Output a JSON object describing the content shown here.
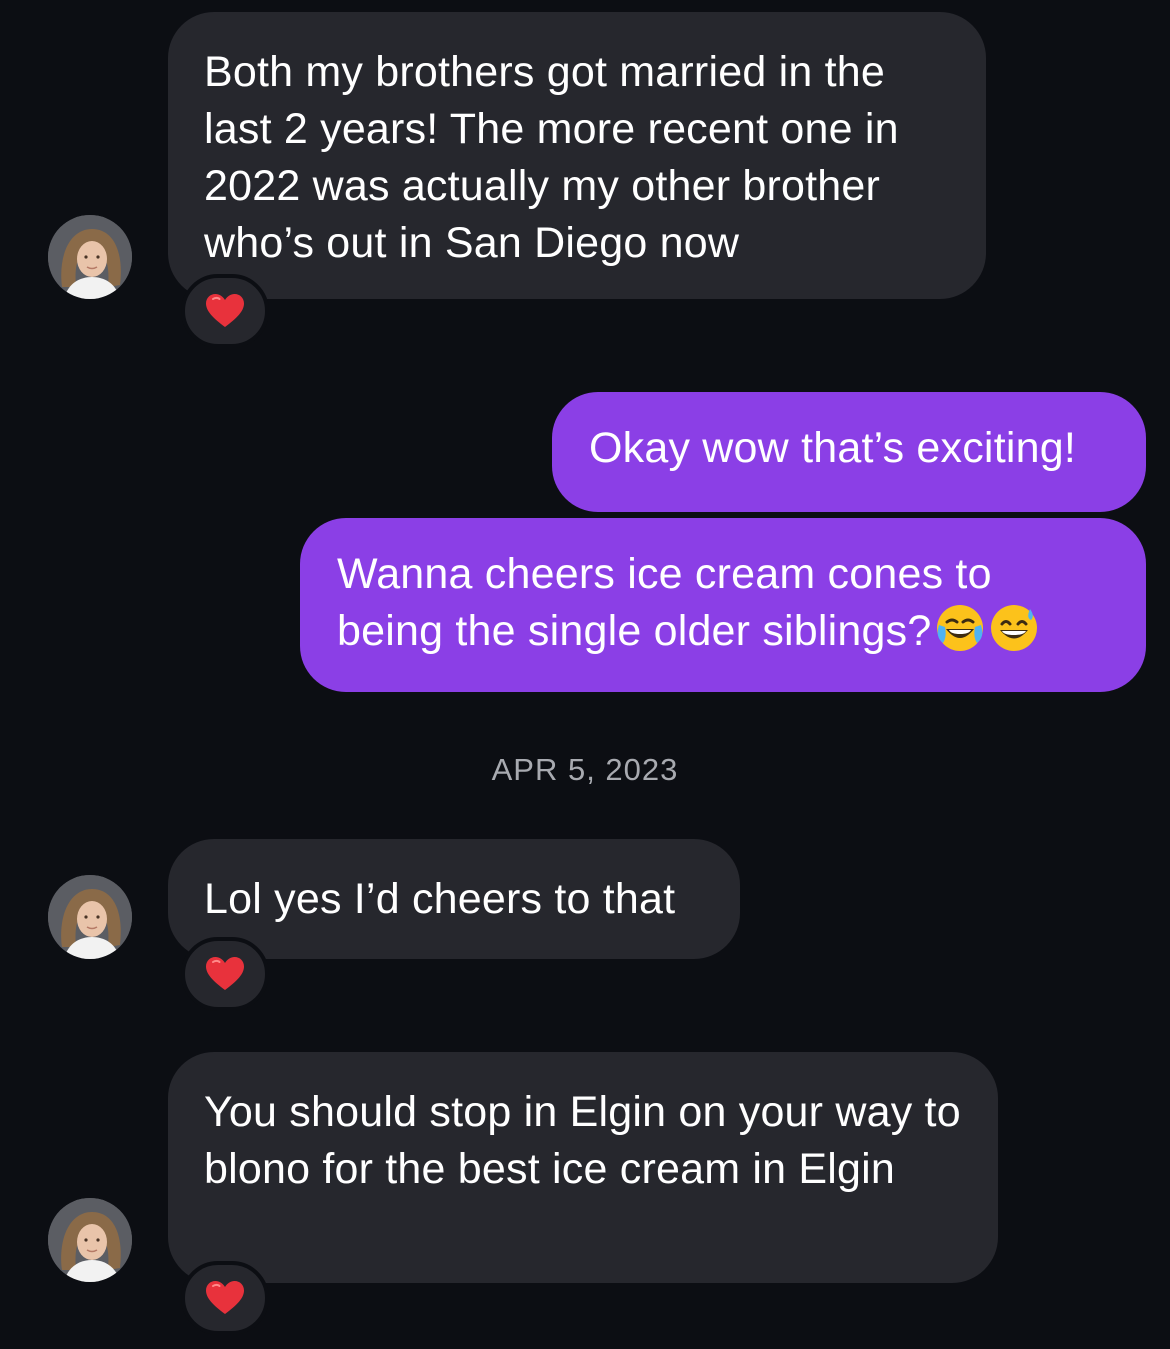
{
  "messages": [
    {
      "direction": "incoming",
      "text": "Both my brothers got married in the last 2 years! The more recent one in 2022 was actually my other brother who’s out in San Diego now",
      "reaction": "heart"
    },
    {
      "direction": "outgoing",
      "text": "Okay wow that’s exciting!"
    },
    {
      "direction": "outgoing",
      "text": "Wanna cheers ice cream cones to being the single older siblings?",
      "emojis": [
        "face-with-tears-of-joy",
        "grinning-face-with-sweat"
      ]
    },
    {
      "direction": "incoming",
      "text": "Lol yes I’d cheers to that",
      "reaction": "heart"
    },
    {
      "direction": "incoming",
      "text": "You should stop in Elgin on your way to blono for the best ice cream in Elgin",
      "reaction": "heart"
    }
  ],
  "date_separator": "APR 5, 2023",
  "colors": {
    "background": "#0c0e13",
    "incoming_bubble": "#26272d",
    "outgoing_bubble": "#8b3fe6",
    "reaction_heart": "#e8323c",
    "date_text": "#a8aab0"
  }
}
